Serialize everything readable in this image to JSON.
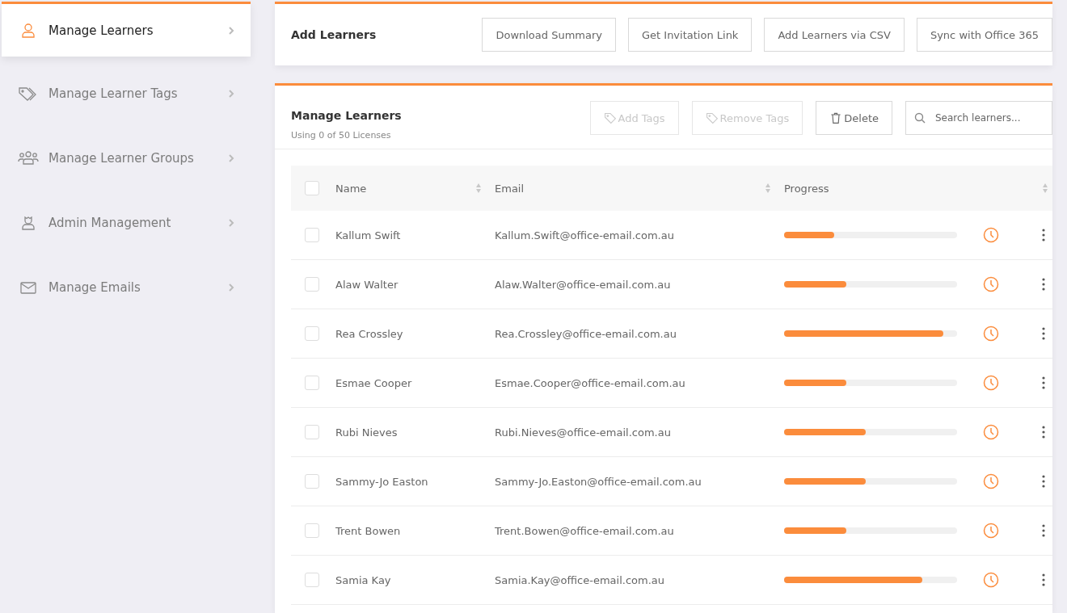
{
  "sidebar": {
    "items": [
      {
        "label": "Manage Learners",
        "kind": "user",
        "selected": true
      },
      {
        "label": "Manage Learner Tags",
        "kind": "tags",
        "selected": false
      },
      {
        "label": "Manage Learner Groups",
        "kind": "group",
        "selected": false
      },
      {
        "label": "Admin Management",
        "kind": "admin",
        "selected": false
      },
      {
        "label": "Manage Emails",
        "kind": "mail",
        "selected": false
      }
    ]
  },
  "add_learners": {
    "title": "Add Learners",
    "buttons": [
      "Download Summary",
      "Get Invitation Link",
      "Add Learners via CSV",
      "Sync with Office 365"
    ]
  },
  "manage": {
    "title": "Manage Learners",
    "subtitle": "Using 0 of 50 Licenses",
    "actions": [
      {
        "label": "Add Tags",
        "kind": "tag",
        "disabled": true
      },
      {
        "label": "Remove Tags",
        "kind": "tag",
        "disabled": true
      },
      {
        "label": "Delete",
        "kind": "trash",
        "disabled": false
      }
    ],
    "search": {
      "placeholder": "Search learners..."
    },
    "table": {
      "all_checked": false,
      "columns": [
        "Name",
        "Email",
        "Progress"
      ],
      "rows": [
        {
          "name": "Kallum Swift",
          "email": "Kallum.Swift@office-email.com.au",
          "level": 0.29,
          "checked": false
        },
        {
          "name": "Alaw Walter",
          "email": "Alaw.Walter@office-email.com.au",
          "level": 0.36,
          "checked": false
        },
        {
          "name": "Rea Crossley",
          "email": "Rea.Crossley@office-email.com.au",
          "level": 0.92,
          "checked": false
        },
        {
          "name": "Esmae Cooper",
          "email": "Esmae.Cooper@office-email.com.au",
          "level": 0.36,
          "checked": false
        },
        {
          "name": "Rubi Nieves",
          "email": "Rubi.Nieves@office-email.com.au",
          "level": 0.47,
          "checked": false
        },
        {
          "name": "Sammy-Jo Easton",
          "email": "Sammy-Jo.Easton@office-email.com.au",
          "level": 0.47,
          "checked": false
        },
        {
          "name": "Trent Bowen",
          "email": "Trent.Bowen@office-email.com.au",
          "level": 0.36,
          "checked": false
        },
        {
          "name": "Samia Kay",
          "email": "Samia.Kay@office-email.com.au",
          "level": 0.8,
          "checked": false
        }
      ]
    }
  }
}
